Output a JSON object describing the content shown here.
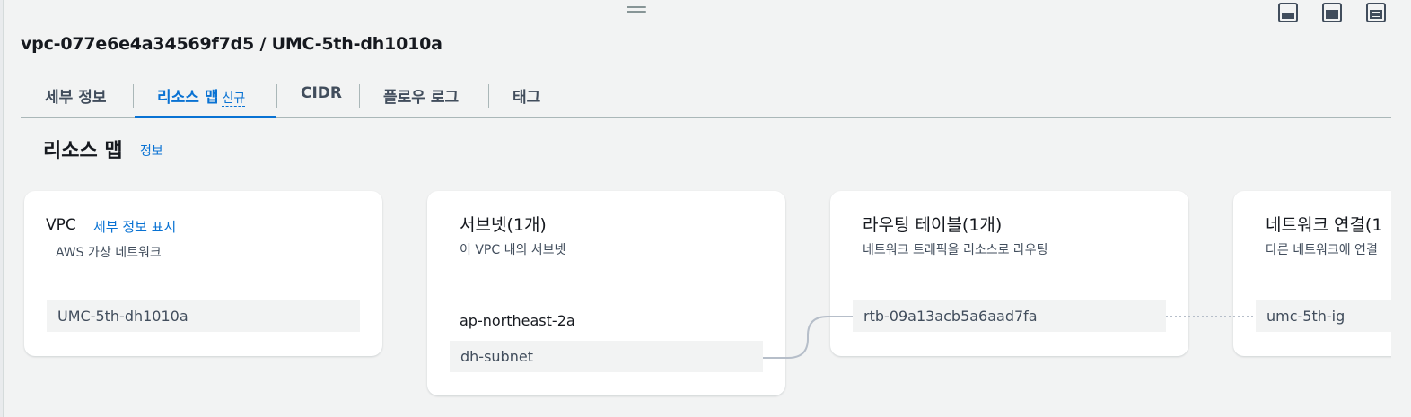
{
  "header": {
    "title": "vpc-077e6e4a34569f7d5 / UMC-5th-dh1010a"
  },
  "tabs": [
    {
      "label": "세부 정보"
    },
    {
      "label": "리소스 맵",
      "badge": "신규",
      "active": true
    },
    {
      "label": "CIDR"
    },
    {
      "label": "플로우 로그"
    },
    {
      "label": "태그"
    }
  ],
  "section": {
    "title": "리소스 맵",
    "info_link": "정보"
  },
  "cards": {
    "vpc": {
      "title": "VPC",
      "link": "세부 정보 표시",
      "subtitle": "AWS 가상 네트워크",
      "item": "UMC-5th-dh1010a"
    },
    "subnet": {
      "title": "서브넷(1개)",
      "subtitle": "이 VPC 내의 서브넷",
      "az": "ap-northeast-2a",
      "item": "dh-subnet"
    },
    "route_table": {
      "title": "라우팅 테이블(1개)",
      "subtitle": "네트워크 트래픽을 리소스로 라우팅",
      "item": "rtb-09a13acb5a6aad7fa"
    },
    "network": {
      "title": "네트워크 연결(1",
      "subtitle": "다른 네트워크에 연결",
      "item": "umc-5th-ig"
    }
  },
  "icons": {
    "layout_bottom": "panel-bottom-icon",
    "layout_side": "panel-side-icon",
    "layout_full": "panel-maximize-icon"
  },
  "colors": {
    "accent": "#0972d3",
    "background": "#f2f3f3",
    "card": "#ffffff",
    "connector": "#b6bec9"
  }
}
